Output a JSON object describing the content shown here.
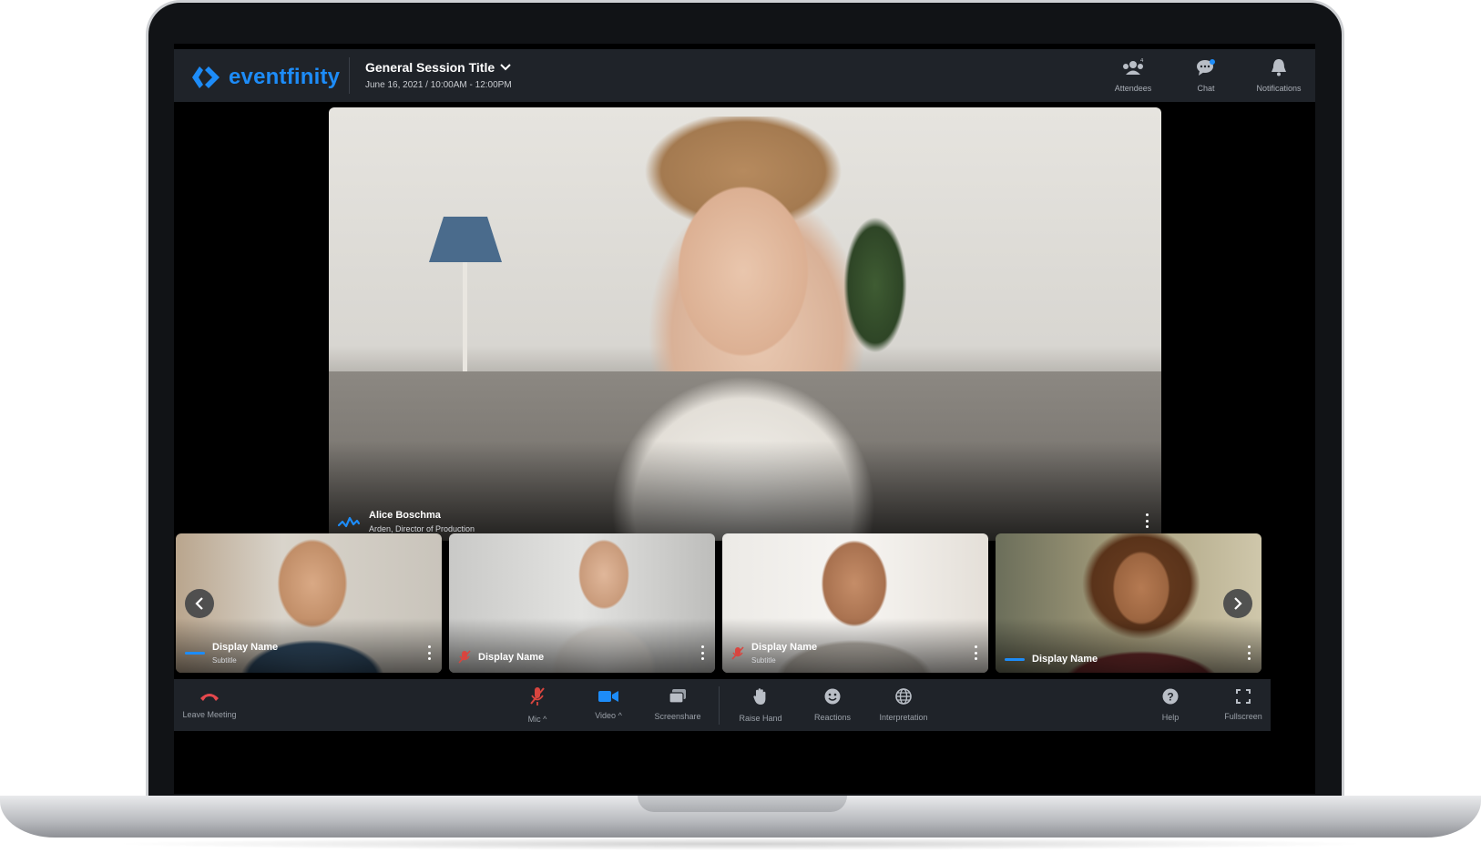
{
  "brand": {
    "name": "eventfinity",
    "color": "#1d8cf8"
  },
  "session": {
    "title": "General Session Title",
    "date": "June 16, 2021 / 10:00AM - 12:00PM"
  },
  "top_actions": [
    {
      "label": "Attendees",
      "icon": "attendees-icon"
    },
    {
      "label": "Chat",
      "icon": "chat-icon"
    },
    {
      "label": "Notifications",
      "icon": "bell-icon"
    }
  ],
  "speaker": {
    "name": "Alice Boschma",
    "subtitle": "Arden, Director of Production"
  },
  "participants": [
    {
      "name": "Display Name",
      "subtitle": "Subtitle",
      "status": "speaking"
    },
    {
      "name": "Display Name",
      "subtitle": "",
      "status": "muted"
    },
    {
      "name": "Display Name",
      "subtitle": "Subtitle",
      "status": "muted"
    },
    {
      "name": "Display Name",
      "subtitle": "",
      "status": "speaking"
    }
  ],
  "toolbar": {
    "leave": "Leave Meeting",
    "mic": "Mic",
    "video": "Video",
    "screenshare": "Screenshare",
    "raise_hand": "Raise Hand",
    "reactions": "Reactions",
    "interpretation": "Interpretation",
    "help": "Help",
    "fullscreen": "Fullscreen"
  },
  "colors": {
    "leave": "#e5484d",
    "muted": "#d9453f",
    "accent": "#1d8cf8",
    "bar_bg": "#1f2329"
  }
}
